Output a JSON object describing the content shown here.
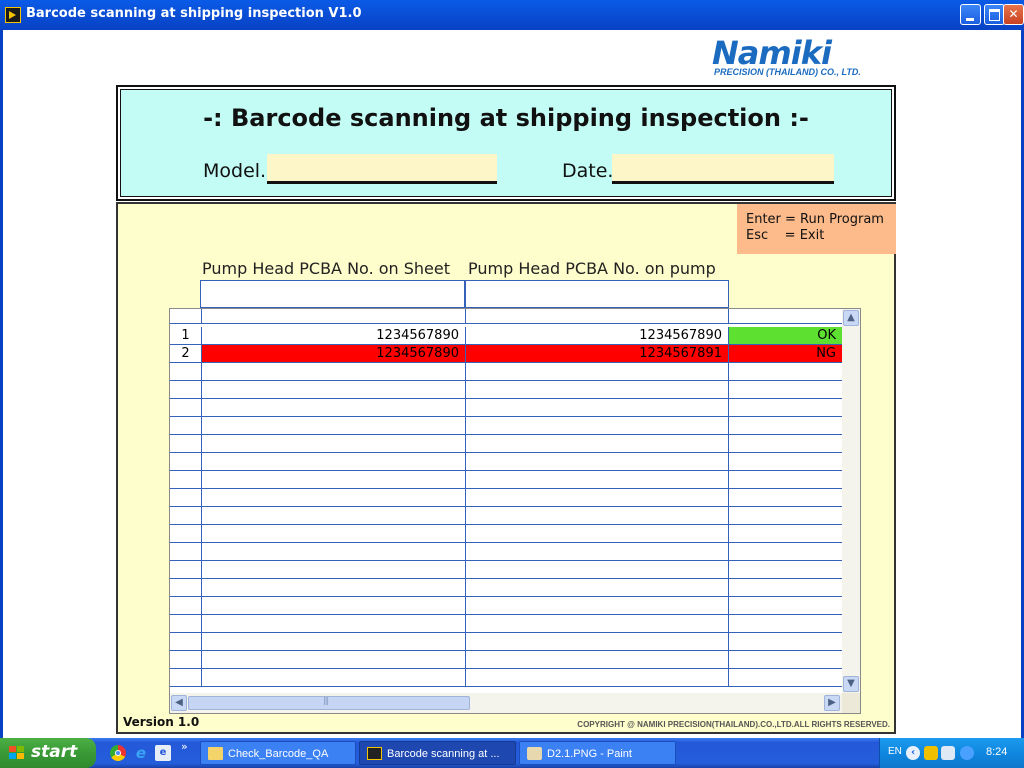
{
  "window": {
    "title": "Barcode scanning at shipping inspection V1.0"
  },
  "logo": {
    "brand": "Namiki",
    "subtitle": "PRECISION (THAILAND) CO., LTD."
  },
  "header": {
    "heading": "-: Barcode scanning at shipping inspection :-",
    "model_label": "Model.",
    "model_value": "",
    "date_label": "Date.",
    "date_value": ""
  },
  "key_hint": {
    "enter": "Enter = Run Program",
    "esc": "Esc    = Exit"
  },
  "columns": {
    "sheet": "Pump Head PCBA No. on Sheet",
    "pump": "Pump Head PCBA No. on pump"
  },
  "table": {
    "rows": [
      {
        "no": "1",
        "sheet": "1234567890",
        "pump": "1234567890",
        "result": "OK",
        "status": "ok"
      },
      {
        "no": "2",
        "sheet": "1234567890",
        "pump": "1234567891",
        "result": "NG",
        "status": "ng"
      }
    ],
    "empty_rows": 18
  },
  "footer": {
    "version": "Version 1.0",
    "copyright": "COPYRIGHT @    NAMIKI PRECISION(THAILAND).CO.,LTD.ALL RIGHTS RESERVED."
  },
  "taskbar": {
    "start_label": "start",
    "quicklaunch_icons": [
      "chrome-icon",
      "internet-explorer-icon",
      "browser-icon"
    ],
    "tasks": [
      {
        "label": "Check_Barcode_QA",
        "icon": "folder-icon",
        "active": false
      },
      {
        "label": "Barcode scanning at ...",
        "icon": "labview-icon",
        "active": true
      },
      {
        "label": "D2.1.PNG - Paint",
        "icon": "paint-icon",
        "active": false
      }
    ],
    "tray": {
      "lang": "EN",
      "clock": "8:24"
    }
  },
  "colors": {
    "header_bg": "#c3fbf5",
    "panel_bg": "#fefdcc",
    "input_bg": "#fdf6c8",
    "hint_bg": "#fdba8a",
    "ok": "#5ee030",
    "ng": "#ff0000",
    "grid": "#3561b8"
  }
}
